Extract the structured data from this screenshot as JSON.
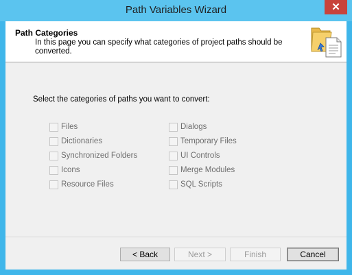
{
  "window": {
    "title": "Path Variables Wizard",
    "close_glyph": "✕",
    "accent_color": "#3fb6ea"
  },
  "header": {
    "title": "Path Categories",
    "description": "In this page you can specify what categories of project paths should be converted.",
    "icon": "folder-document-icon"
  },
  "main": {
    "prompt": "Select the categories of paths you want to convert:",
    "categories_left": [
      {
        "label": "Files",
        "checked": false,
        "enabled": false
      },
      {
        "label": "Dictionaries",
        "checked": false,
        "enabled": false
      },
      {
        "label": "Synchronized Folders",
        "checked": false,
        "enabled": false
      },
      {
        "label": "Icons",
        "checked": false,
        "enabled": false
      },
      {
        "label": "Resource Files",
        "checked": false,
        "enabled": false
      }
    ],
    "categories_right": [
      {
        "label": "Dialogs",
        "checked": false,
        "enabled": false
      },
      {
        "label": "Temporary Files",
        "checked": false,
        "enabled": false
      },
      {
        "label": "UI Controls",
        "checked": false,
        "enabled": false
      },
      {
        "label": "Merge Modules",
        "checked": false,
        "enabled": false
      },
      {
        "label": "SQL Scripts",
        "checked": false,
        "enabled": false
      }
    ]
  },
  "footer": {
    "back_label": "< Back",
    "next_label": "Next >",
    "finish_label": "Finish",
    "cancel_label": "Cancel"
  }
}
